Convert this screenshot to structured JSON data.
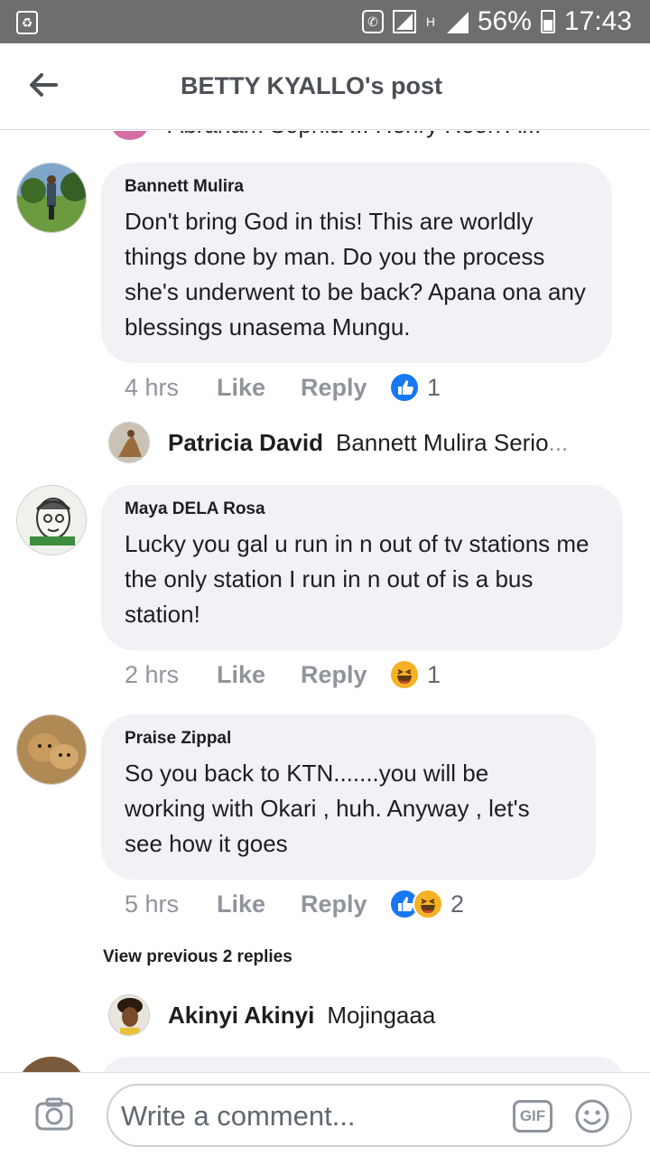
{
  "status_bar": {
    "battery": "56%",
    "time": "17:43",
    "network": "H"
  },
  "header": {
    "title": "BETTY KYALLO's post"
  },
  "partial_comment": {
    "text": "Abraham Sophia ... Henry Roon A..."
  },
  "comments": [
    {
      "author": "Bannett Mulira",
      "text": "Don't bring God in this! This are worldly things done by man. Do you the process she's underwent to be back? Apana ona any blessings unasema Mungu.",
      "time": "4 hrs",
      "like_label": "Like",
      "reply_label": "Reply",
      "reaction_count": "1",
      "reactions": [
        "like"
      ]
    },
    {
      "author": "Maya DELA Rosa",
      "text": "Lucky you gal u run in n out of tv stations me the only station I run in n out of is a bus station!",
      "time": "2 hrs",
      "like_label": "Like",
      "reply_label": "Reply",
      "reaction_count": "1",
      "reactions": [
        "haha"
      ]
    },
    {
      "author": "Praise Zippal",
      "text": "So you back to KTN.......you will be working with Okari , huh. Anyway , let's see how it goes",
      "time": "5 hrs",
      "like_label": "Like",
      "reply_label": "Reply",
      "reaction_count": "2",
      "reactions": [
        "like",
        "haha"
      ]
    }
  ],
  "replies": [
    {
      "name": "Patricia David",
      "text": "Bannett Mulira Serio",
      "ellipsis": "..."
    },
    {
      "name": "Akinyi Akinyi",
      "text": "Mojingaaa",
      "ellipsis": ""
    }
  ],
  "view_previous": "View previous 2 replies",
  "composer": {
    "placeholder": "Write a comment...",
    "gif_label": "GIF"
  },
  "colors": {
    "bubble": "#f0f2f5",
    "like_blue": "#1877f2",
    "haha_yellow": "#f7b125",
    "status_bar": "#6e6e6e"
  }
}
